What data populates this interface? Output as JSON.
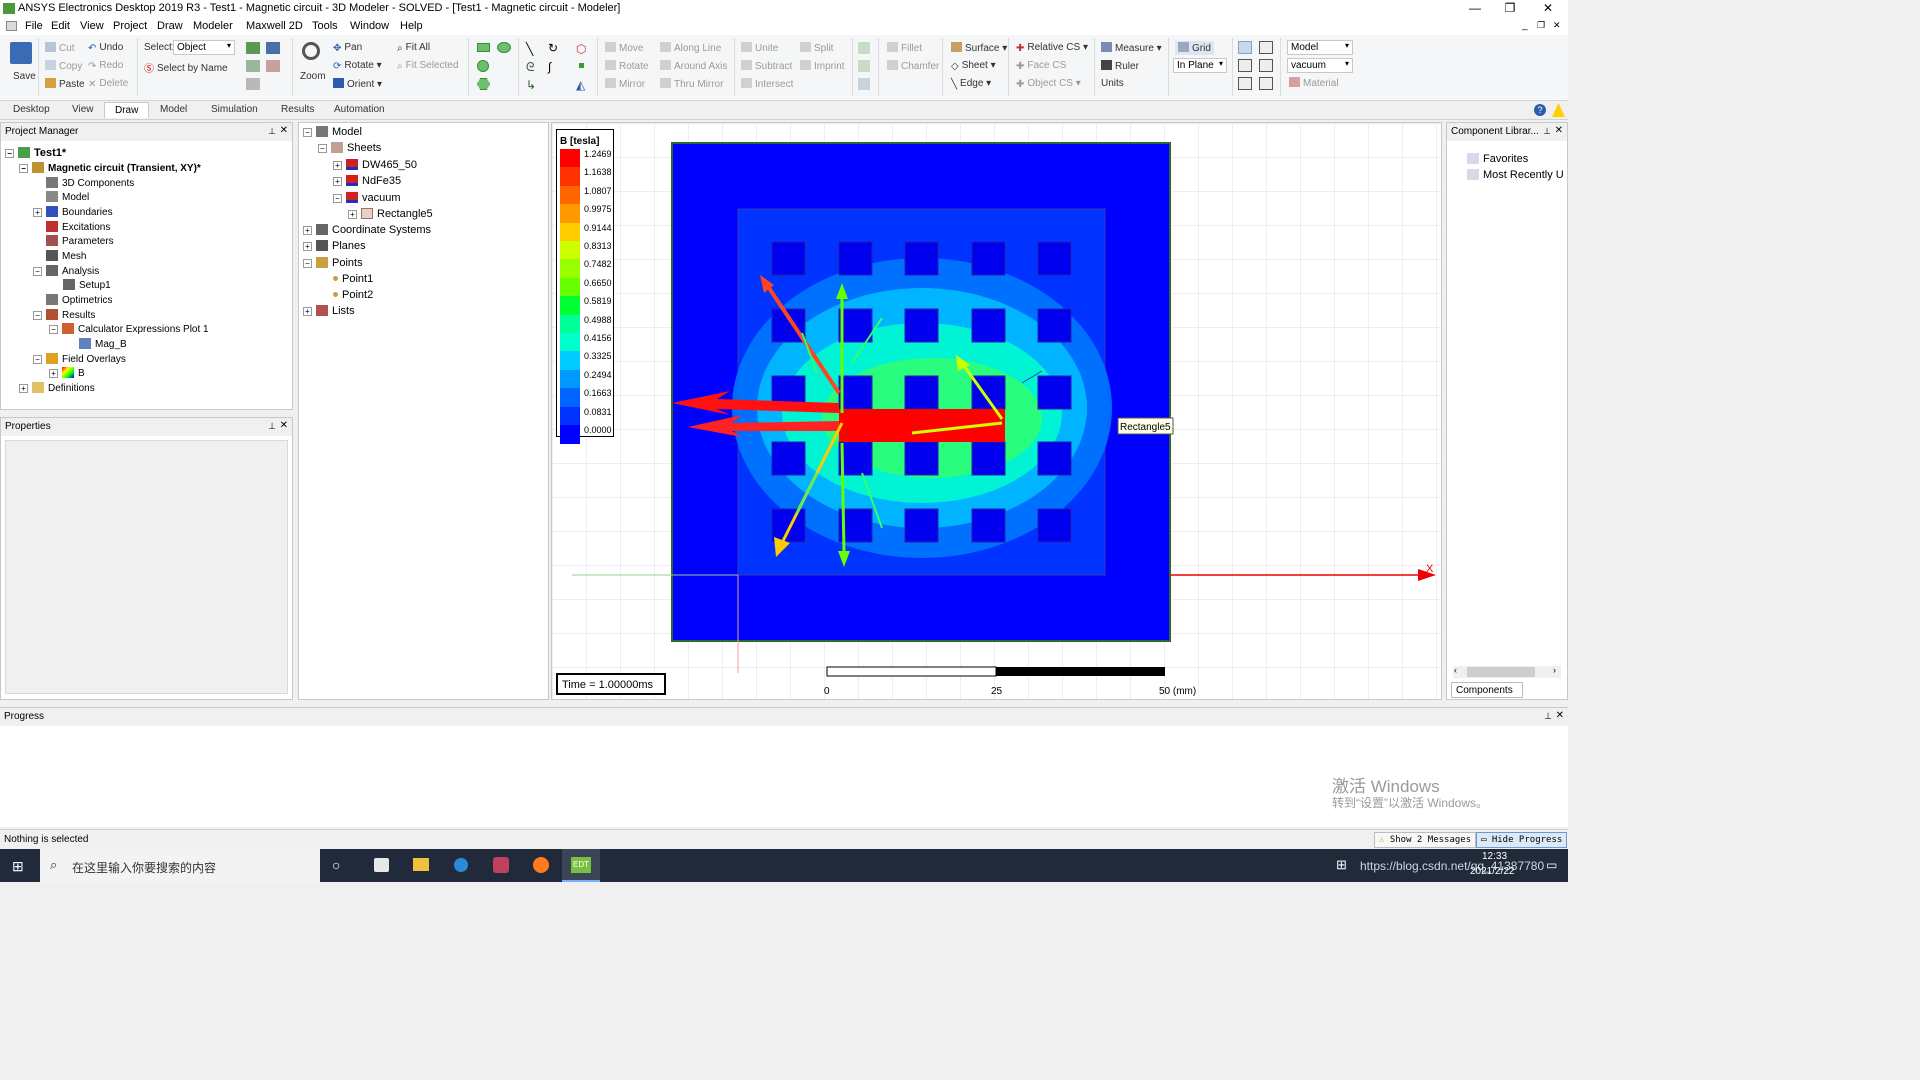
{
  "window": {
    "title": "ANSYS Electronics Desktop 2019 R3 - Test1 - Magnetic circuit - 3D Modeler - SOLVED - [Test1 - Magnetic circuit - Modeler]"
  },
  "menu": [
    "File",
    "Edit",
    "View",
    "Project",
    "Draw",
    "Modeler",
    "Maxwell 2D",
    "Tools",
    "Window",
    "Help"
  ],
  "ribbon": {
    "save": "Save",
    "cut": "Cut",
    "copy": "Copy",
    "paste": "Paste",
    "undo": "Undo",
    "redo": "Redo",
    "delete": "Delete",
    "select_label": "Select:",
    "select_value": "Object",
    "select_by_name": "Select by Name",
    "zoom": "Zoom",
    "pan": "Pan",
    "rotate": "Rotate",
    "orient": "Orient",
    "fit_all": "Fit All",
    "fit_selected": "Fit Selected",
    "move": "Move",
    "rotate2": "Rotate",
    "mirror": "Mirror",
    "along_line": "Along Line",
    "around_axis": "Around Axis",
    "thru_mirror": "Thru Mirror",
    "unite": "Unite",
    "subtract": "Subtract",
    "intersect": "Intersect",
    "split": "Split",
    "imprint": "Imprint",
    "fillet": "Fillet",
    "chamfer": "Chamfer",
    "surface": "Surface",
    "sheet": "Sheet",
    "edge": "Edge",
    "relative_cs": "Relative CS",
    "face_cs": "Face CS",
    "object_cs": "Object CS",
    "measure": "Measure",
    "ruler": "Ruler",
    "units": "Units",
    "grid": "Grid",
    "in_plane": "In Plane",
    "model_combo": "Model",
    "material_combo": "vacuum",
    "material": "Material"
  },
  "tabs": [
    "Desktop",
    "View",
    "Draw",
    "Model",
    "Simulation",
    "Results",
    "Automation"
  ],
  "active_tab": "Draw",
  "project_manager": {
    "title": "Project Manager",
    "items": [
      "Test1*",
      "Magnetic circuit (Transient, XY)*",
      "3D Components",
      "Model",
      "Boundaries",
      "Excitations",
      "Parameters",
      "Mesh",
      "Analysis",
      "Setup1",
      "Optimetrics",
      "Results",
      "Calculator Expressions Plot 1",
      "Mag_B",
      "Field Overlays",
      "B",
      "Definitions"
    ]
  },
  "properties": {
    "title": "Properties"
  },
  "model_tree": {
    "items": [
      "Model",
      "Sheets",
      "DW465_50",
      "NdFe35",
      "vacuum",
      "Rectangle5",
      "Coordinate Systems",
      "Planes",
      "Points",
      "Point1",
      "Point2",
      "Lists"
    ]
  },
  "legend": {
    "title": "B [tesla]",
    "values": [
      "1.2469",
      "1.1638",
      "1.0807",
      "0.9975",
      "0.9144",
      "0.8313",
      "0.7482",
      "0.6650",
      "0.5819",
      "0.4988",
      "0.4156",
      "0.3325",
      "0.2494",
      "0.1663",
      "0.0831",
      "0.0000"
    ],
    "colors": [
      "#ff0000",
      "#ff3300",
      "#ff6600",
      "#ff9900",
      "#ffcc00",
      "#ccff00",
      "#99ff00",
      "#66ff00",
      "#00ff33",
      "#00ff99",
      "#00ffcc",
      "#00ccff",
      "#0099ff",
      "#0066ff",
      "#0033ff",
      "#0000ff"
    ]
  },
  "time_label": "Time    = 1.00000ms",
  "scale": {
    "labels": [
      "0",
      "25",
      "50 (mm)"
    ]
  },
  "tooltip": "Rectangle5",
  "axis_label": "X",
  "component_library": {
    "title": "Component Librar...",
    "items": [
      "Favorites",
      "Most Recently U"
    ],
    "tab": "Components"
  },
  "progress": {
    "title": "Progress"
  },
  "watermark": {
    "line1": "激活 Windows",
    "line2": "转到“设置”以激活 Windows。"
  },
  "status": {
    "text": "Nothing is selected",
    "show_messages": "Show 2 Messages",
    "hide_progress": "Hide Progress"
  },
  "taskbar": {
    "search_placeholder": "在这里输入你要搜索的内容",
    "time": "12:33",
    "date": "2021/2/22",
    "url_watermark": "https://blog.csdn.net/qq_41387780"
  }
}
